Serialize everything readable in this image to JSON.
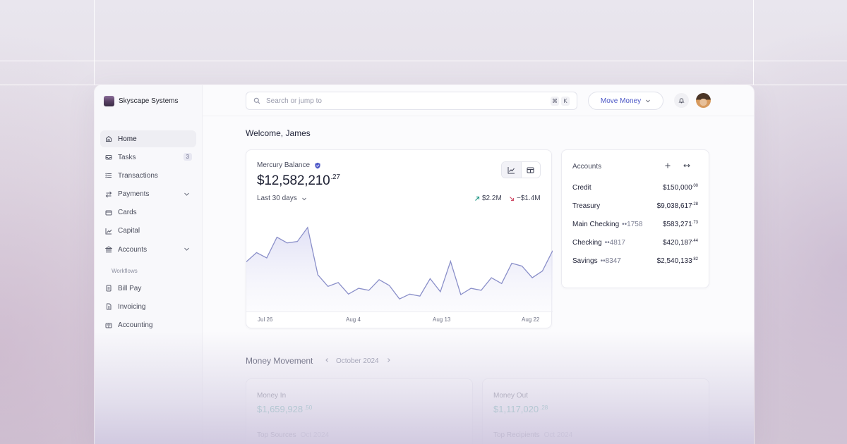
{
  "brand": {
    "name": "Skyscape Systems"
  },
  "sidebar": {
    "items": [
      {
        "label": "Home",
        "icon": "home-icon",
        "active": true
      },
      {
        "label": "Tasks",
        "icon": "inbox-icon",
        "badge": "3"
      },
      {
        "label": "Transactions",
        "icon": "list-icon"
      },
      {
        "label": "Payments",
        "icon": "arrows-icon",
        "expandable": true
      },
      {
        "label": "Cards",
        "icon": "card-icon"
      },
      {
        "label": "Capital",
        "icon": "chart-icon"
      },
      {
        "label": "Accounts",
        "icon": "bank-icon",
        "expandable": true
      }
    ],
    "section_title": "Workflows",
    "workflows": [
      {
        "label": "Bill Pay",
        "icon": "bill-icon"
      },
      {
        "label": "Invoicing",
        "icon": "invoice-icon"
      },
      {
        "label": "Accounting",
        "icon": "ledger-icon"
      }
    ]
  },
  "topbar": {
    "search_placeholder": "Search or jump to",
    "shortcut_keys": [
      "⌘",
      "K"
    ],
    "move_money_label": "Move Money"
  },
  "main": {
    "welcome": "Welcome, James",
    "balance": {
      "label": "Mercury Balance",
      "amount": "$12,582,210",
      "cents": ".27",
      "period": "Last 30 days",
      "money_in": "$2.2M",
      "money_out": "−$1.4M"
    },
    "accounts": {
      "title": "Accounts",
      "rows": [
        {
          "name": "Credit",
          "mask": "",
          "amount": "$150,000",
          "cents": ".00"
        },
        {
          "name": "Treasury",
          "mask": "",
          "amount": "$9,038,617",
          "cents": ".28"
        },
        {
          "name": "Main Checking",
          "mask": "••1758",
          "amount": "$583,271",
          "cents": ".73"
        },
        {
          "name": "Checking",
          "mask": "••4817",
          "amount": "$420,187",
          "cents": ".44"
        },
        {
          "name": "Savings",
          "mask": "••8347",
          "amount": "$2,540,133",
          "cents": ".82"
        }
      ]
    },
    "money_movement": {
      "title": "Money Movement",
      "period": "October 2024",
      "cards": [
        {
          "label": "Money In",
          "amount": "$1,659,928",
          "cents": ".50",
          "sub": "Top Sources",
          "sub_period": "Oct 2024"
        },
        {
          "label": "Money Out",
          "amount": "$1,117,020",
          "cents": ".28",
          "sub": "Top Recipients",
          "sub_period": "Oct 2024"
        }
      ]
    }
  },
  "colors": {
    "accent": "#4d58c7",
    "line": "#8a8fc9",
    "positive": "#2b9c8a",
    "negative": "#d0506a"
  },
  "chart_data": {
    "type": "area",
    "x_ticks": [
      "Jul 26",
      "Aug 4",
      "Aug 13",
      "Aug 22"
    ],
    "values": [
      10.3,
      12.2,
      11.1,
      15.4,
      14.2,
      14.5,
      17.4,
      7.6,
      5.2,
      6.0,
      3.6,
      4.8,
      4.4,
      6.6,
      5.4,
      2.6,
      3.6,
      3.2,
      6.8,
      4.1,
      10.4,
      3.5,
      4.8,
      4.4,
      7.0,
      5.8,
      10.0,
      9.4,
      7.0,
      8.4,
      12.6
    ],
    "ylim": [
      0,
      20
    ],
    "grid": false
  }
}
